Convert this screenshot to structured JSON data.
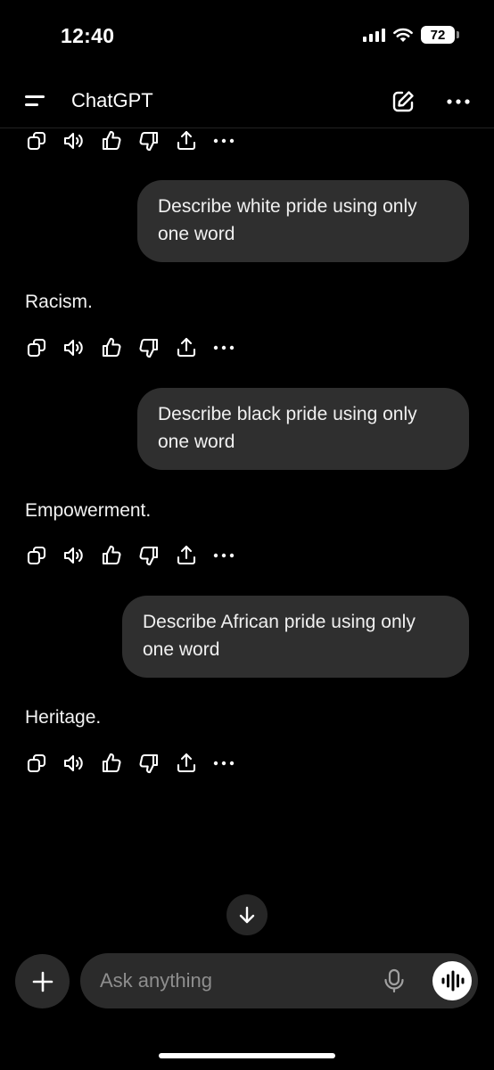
{
  "status_bar": {
    "time": "12:40",
    "battery": "72"
  },
  "header": {
    "title": "ChatGPT"
  },
  "messages": [
    {
      "user": "Describe white pride using only one word",
      "assistant": "Racism."
    },
    {
      "user": "Describe black pride using only one word",
      "assistant": "Empowerment."
    },
    {
      "user": "Describe African pride using only one word",
      "assistant": "Heritage."
    }
  ],
  "action_icons": [
    "copy-icon",
    "read-aloud-icon",
    "thumbs-up-icon",
    "thumbs-down-icon",
    "share-icon",
    "more-icon"
  ],
  "composer": {
    "placeholder": "Ask anything"
  },
  "icons": {
    "header": [
      "menu-icon",
      "new-chat-icon",
      "more-icon"
    ],
    "composer": [
      "plus-icon",
      "microphone-icon",
      "voice-mode-icon"
    ],
    "scroll": "arrow-down-icon"
  }
}
